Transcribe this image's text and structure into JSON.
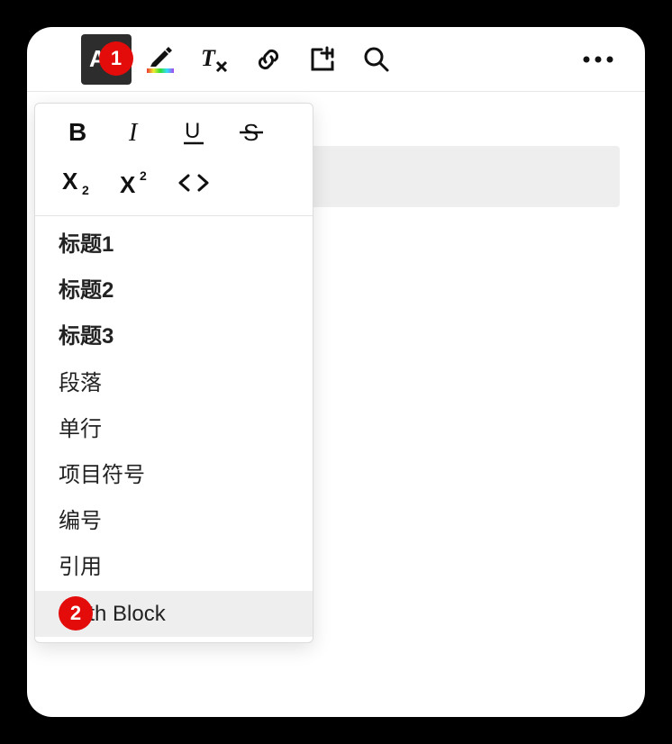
{
  "badges": {
    "one": "1",
    "two": "2"
  },
  "dropdown": {
    "format_row1": [
      {
        "name": "bold-icon"
      },
      {
        "name": "italic-icon"
      },
      {
        "name": "underline-icon"
      },
      {
        "name": "strikethrough-icon"
      }
    ],
    "format_row2": [
      {
        "name": "subscript-icon"
      },
      {
        "name": "superscript-icon"
      },
      {
        "name": "code-icon"
      }
    ],
    "items": [
      {
        "label": "标题1",
        "bold": true
      },
      {
        "label": "标题2",
        "bold": true
      },
      {
        "label": "标题3",
        "bold": true
      },
      {
        "label": "段落",
        "bold": false
      },
      {
        "label": "单行",
        "bold": false
      },
      {
        "label": "项目符号",
        "bold": false
      },
      {
        "label": "编号",
        "bold": false
      },
      {
        "label": "引用",
        "bold": false
      },
      {
        "label": "Math Block",
        "bold": false,
        "hovered": true
      }
    ]
  },
  "toolbar": {
    "buttons": [
      {
        "name": "text-format-icon",
        "active": true
      },
      {
        "name": "highlight-icon"
      },
      {
        "name": "clear-format-icon"
      },
      {
        "name": "link-icon"
      },
      {
        "name": "insert-icon"
      },
      {
        "name": "search-icon"
      }
    ]
  }
}
